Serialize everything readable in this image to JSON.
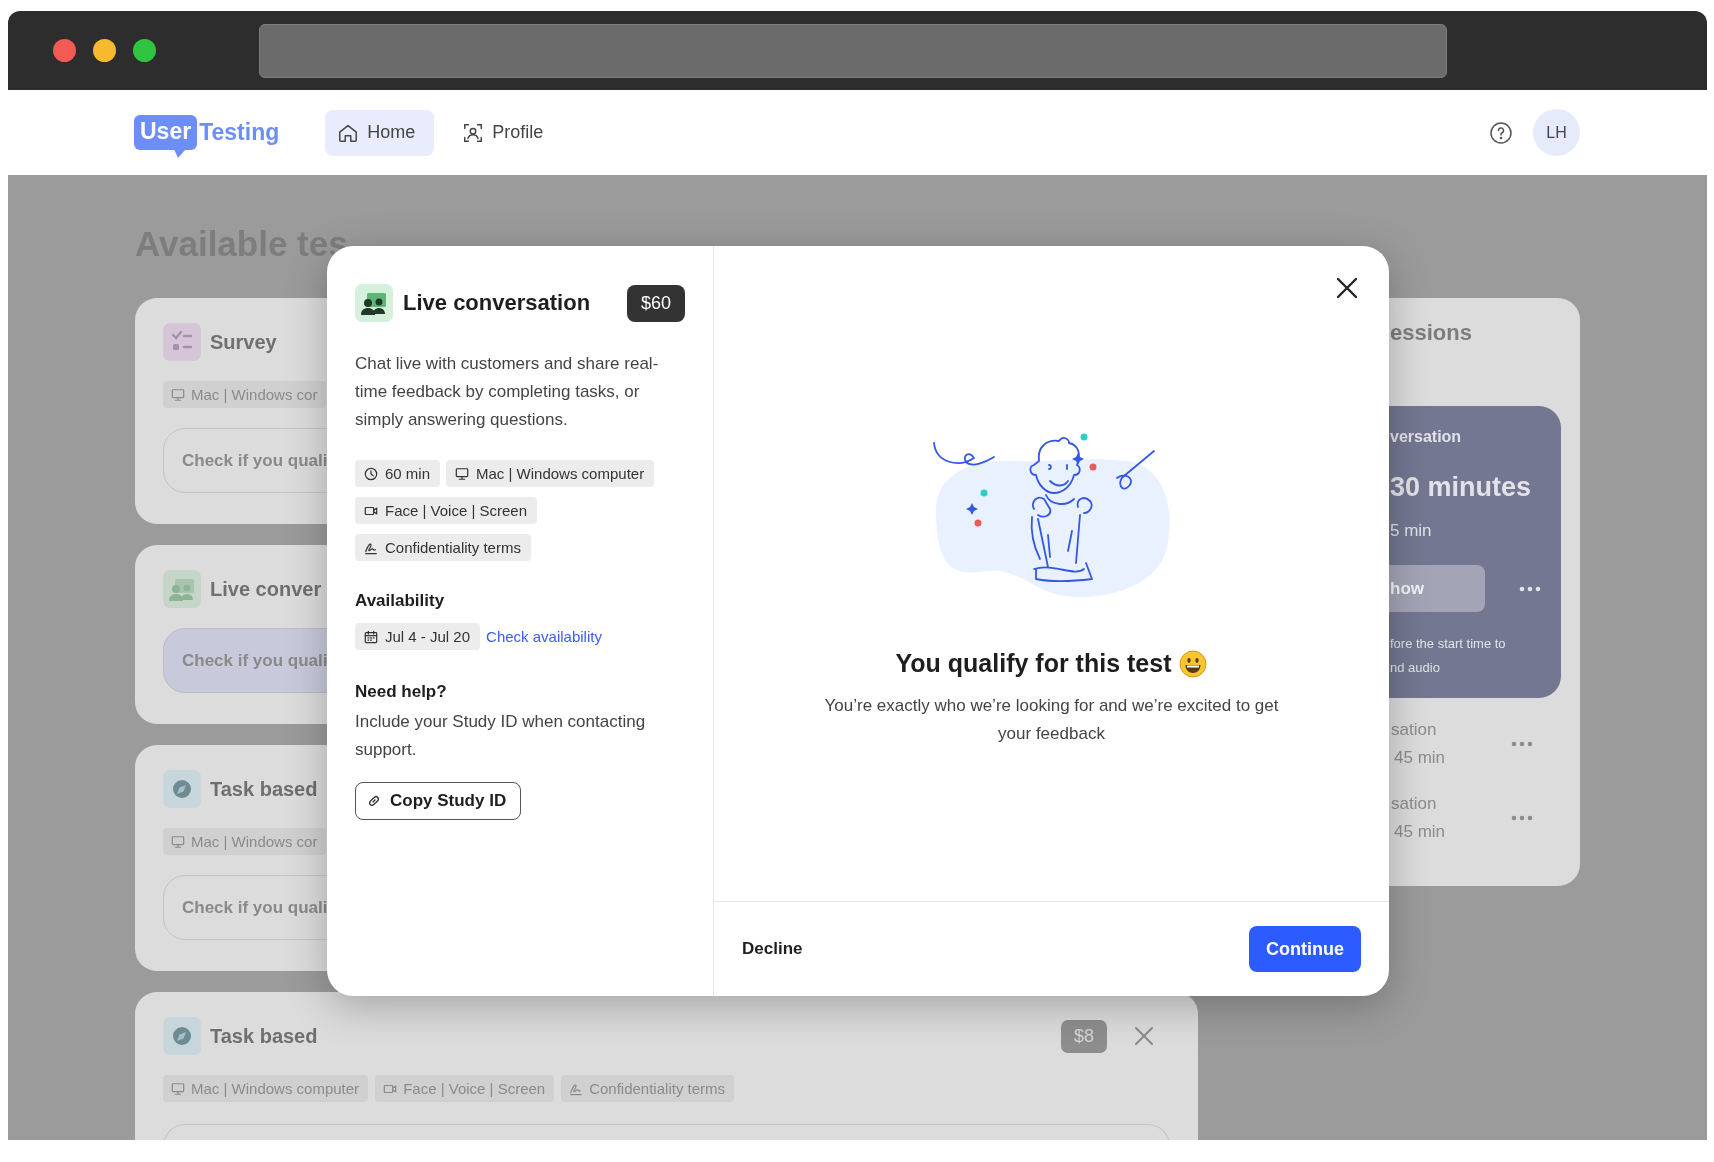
{
  "nav": {
    "logo": {
      "badge": "User",
      "word": "Testing"
    },
    "items": [
      {
        "kind": "home",
        "label": "Home",
        "selected": true
      },
      {
        "kind": "profile",
        "label": "Profile",
        "selected": false
      }
    ],
    "avatar": "LH"
  },
  "page": {
    "title": "Available tes",
    "tests": [
      {
        "kind": "survey",
        "title": "Survey",
        "chips": [
          {
            "kind": "device",
            "text": "Mac | Windows cor"
          }
        ],
        "action": "Check if you quali",
        "highlighted": false
      },
      {
        "kind": "live",
        "title": "Live conver",
        "action": "Check if you quali",
        "highlighted": true
      },
      {
        "kind": "task",
        "title": "Task based",
        "chips": [
          {
            "kind": "device",
            "text": "Mac | Windows cor"
          }
        ],
        "action": "Check if you quali",
        "highlighted": false
      },
      {
        "kind": "task",
        "title": "Task based",
        "price": "$8",
        "chips": [
          {
            "kind": "device",
            "text": "Mac | Windows computer"
          },
          {
            "kind": "recording",
            "text": "Face | Voice | Screen"
          },
          {
            "kind": "terms",
            "text": "Confidentiality terms"
          }
        ]
      }
    ],
    "sessions": {
      "title": "essions",
      "current": {
        "title": "versation",
        "time": "30 minutes",
        "duration": "5 min",
        "button": "how",
        "note": "fore the start time to\nnd audio"
      },
      "rows": [
        {
          "title": "sation",
          "duration": "45 min"
        },
        {
          "title": "sation",
          "duration": "45 min"
        }
      ]
    }
  },
  "modal": {
    "kind": "live",
    "title": "Live conversation",
    "price": "$60",
    "description": "Chat live with customers and share real-time feedback by completing tasks, or simply answering questions.",
    "chips": [
      {
        "kind": "duration",
        "text": "60 min"
      },
      {
        "kind": "device",
        "text": "Mac | Windows computer"
      },
      {
        "kind": "recording",
        "text": "Face | Voice | Screen"
      },
      {
        "kind": "terms",
        "text": "Confidentiality terms"
      }
    ],
    "availability": {
      "heading": "Availability",
      "date": {
        "kind": "date",
        "text": "Jul 4 - Jul 20"
      },
      "link": "Check availability"
    },
    "help": {
      "heading": "Need help?",
      "text": "Include your Study ID when contacting support.",
      "button": "Copy Study ID"
    },
    "result": {
      "heading": "You qualify for this test",
      "message": "You’re exactly who we’re looking for and we’re excited to get your feedback"
    },
    "footer": {
      "decline": "Decline",
      "continue": "Continue"
    }
  }
}
